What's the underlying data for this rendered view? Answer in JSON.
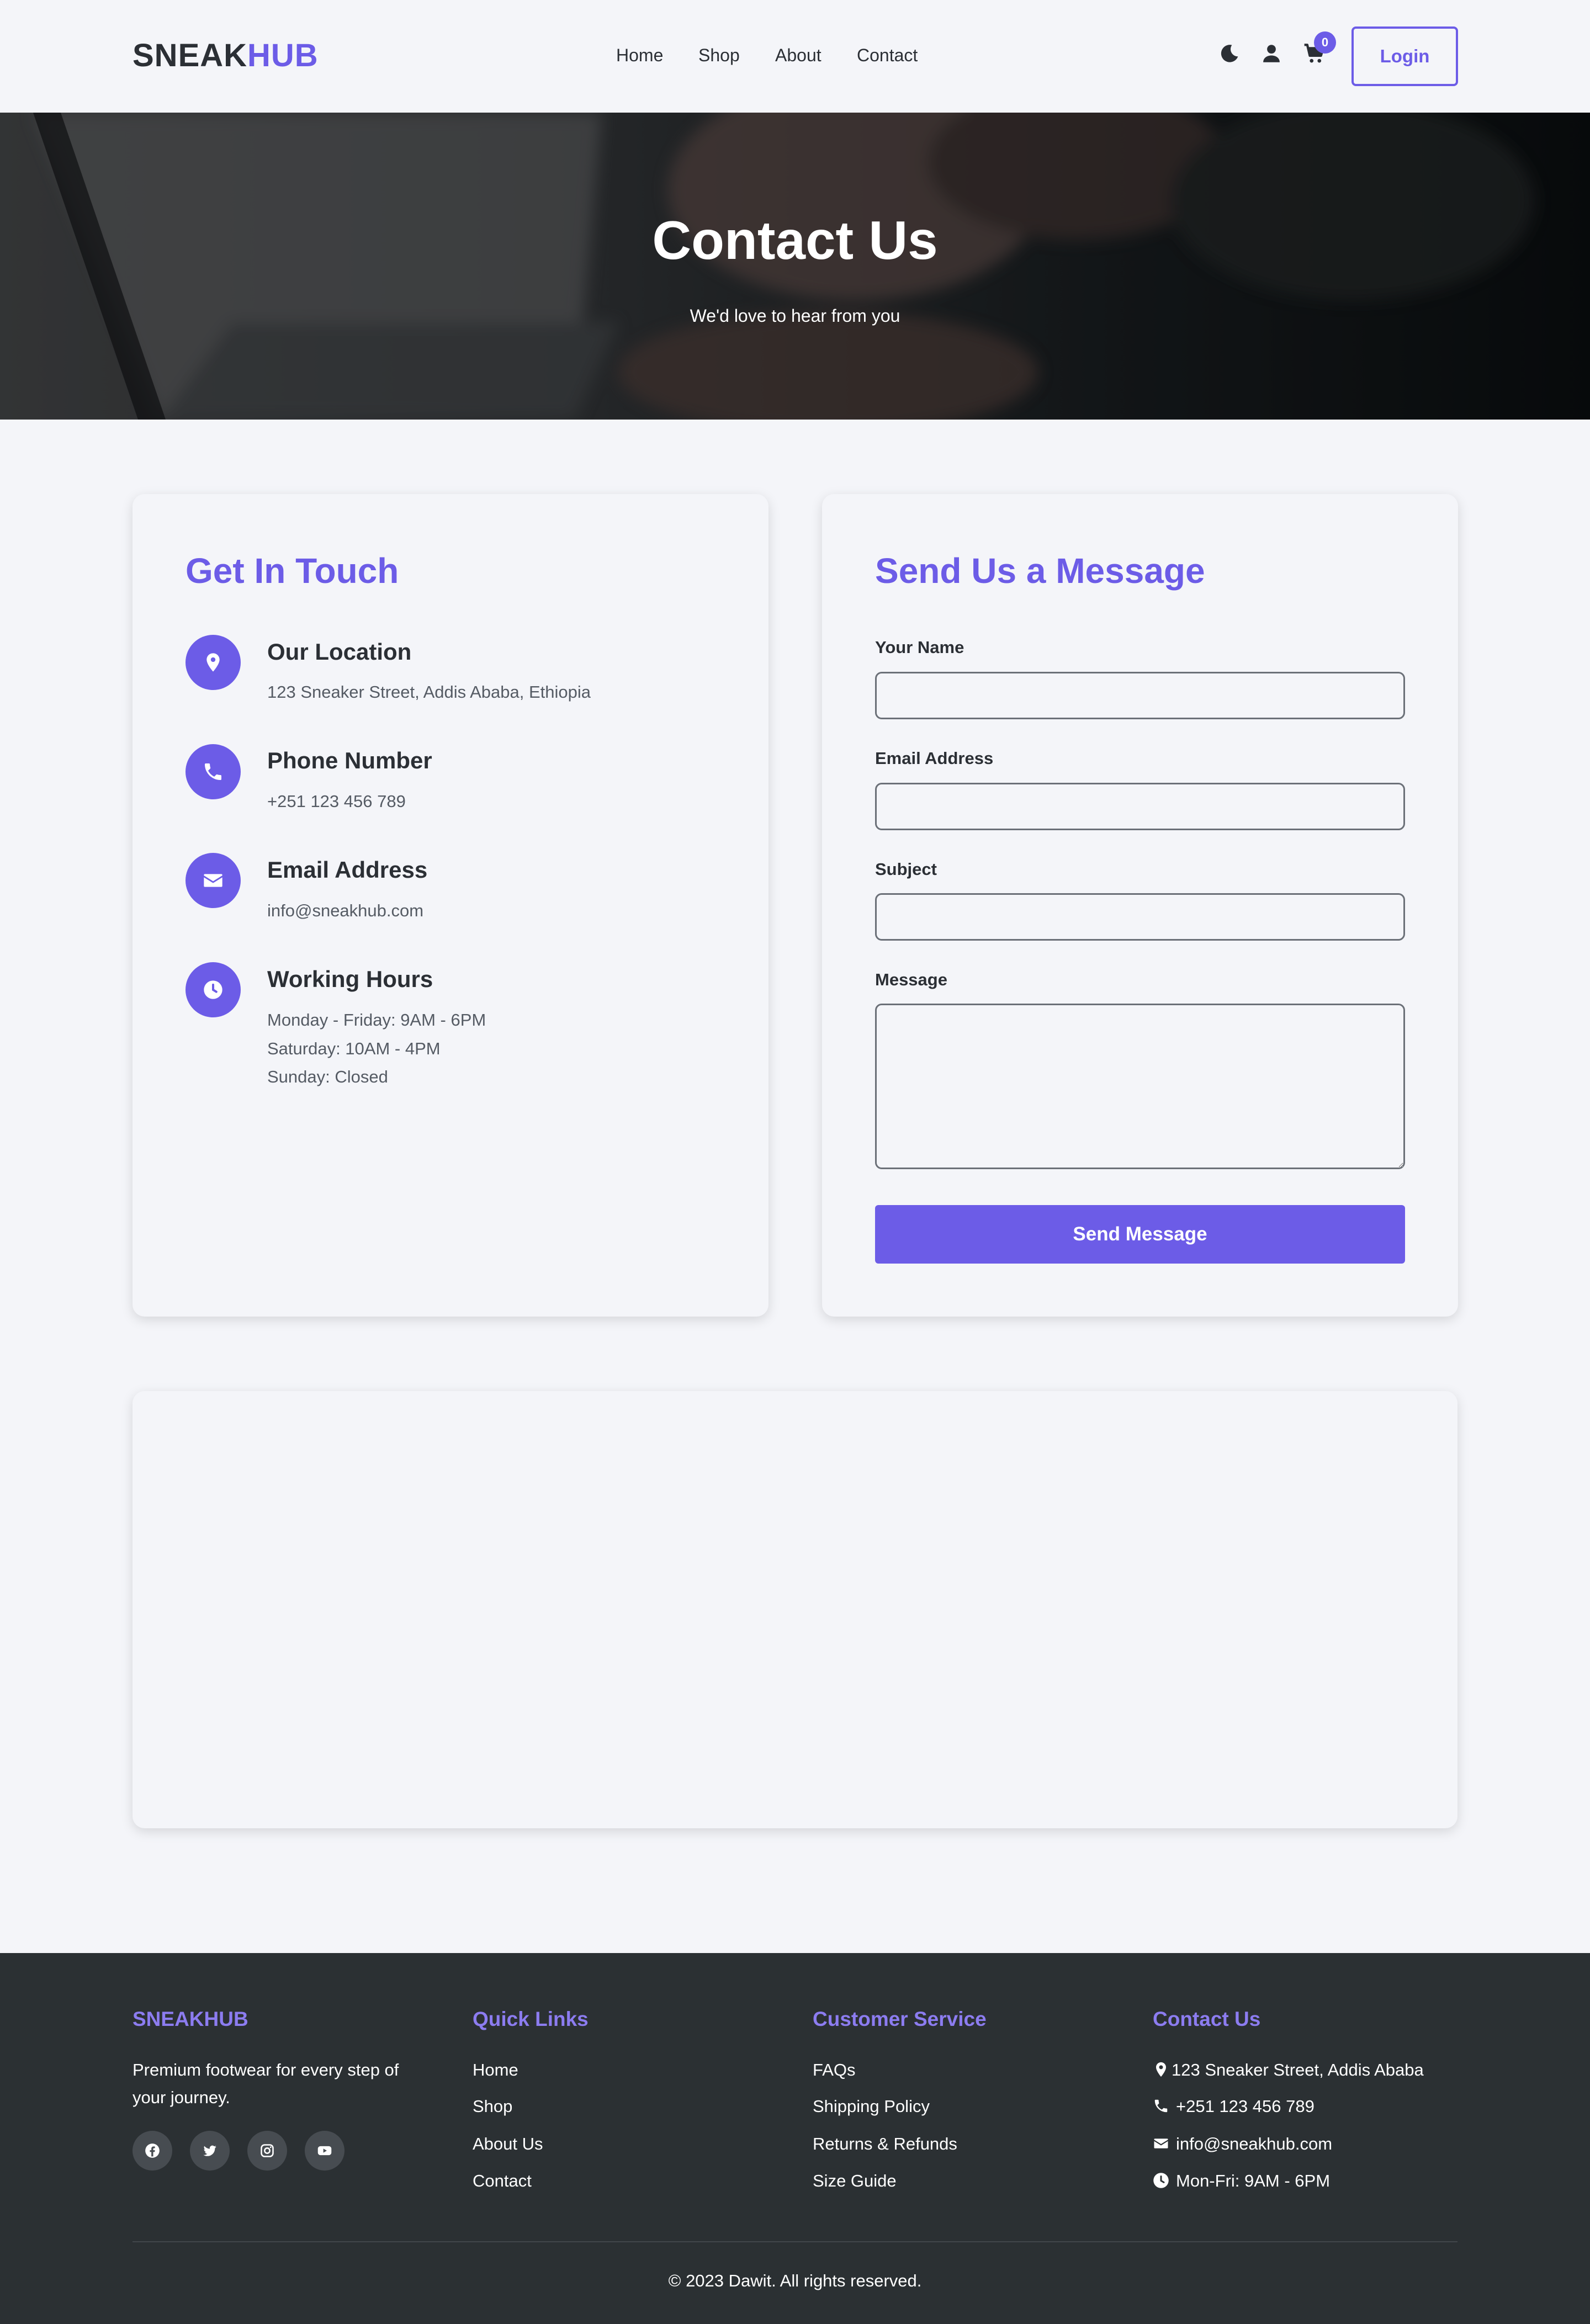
{
  "header": {
    "brand_part1": "SNEAK",
    "brand_part2": "HUB",
    "nav": [
      "Home",
      "Shop",
      "About",
      "Contact"
    ],
    "icons": [
      "moon-icon",
      "user-icon",
      "cart-icon"
    ],
    "cart_count": "0",
    "login_label": "Login"
  },
  "hero": {
    "title": "Contact Us",
    "subtitle": "We'd love to hear from you"
  },
  "contact_info": {
    "title": "Get In Touch",
    "items": [
      {
        "icon": "location-pin-icon",
        "title": "Our Location",
        "lines": [
          "123 Sneaker Street, Addis Ababa, Ethiopia"
        ]
      },
      {
        "icon": "phone-icon",
        "title": "Phone Number",
        "lines": [
          "+251 123 456 789"
        ]
      },
      {
        "icon": "envelope-icon",
        "title": "Email Address",
        "lines": [
          "info@sneakhub.com"
        ]
      },
      {
        "icon": "clock-icon",
        "title": "Working Hours",
        "lines": [
          "Monday - Friday: 9AM - 6PM",
          "Saturday: 10AM - 4PM",
          "Sunday: Closed"
        ]
      }
    ]
  },
  "form": {
    "title": "Send Us a Message",
    "fields": [
      {
        "label": "Your Name",
        "value": ""
      },
      {
        "label": "Email Address",
        "value": ""
      },
      {
        "label": "Subject",
        "value": ""
      },
      {
        "label": "Message",
        "value": ""
      }
    ],
    "submit_label": "Send Message"
  },
  "footer": {
    "brand": {
      "title": "SNEAKHUB",
      "tagline_lines": [
        "Premium footwear for every step of",
        "your journey."
      ],
      "social_icons": [
        "facebook-icon",
        "twitter-icon",
        "instagram-icon",
        "youtube-icon"
      ]
    },
    "quick_links": {
      "title": "Quick Links",
      "items": [
        "Home",
        "Shop",
        "About Us",
        "Contact"
      ]
    },
    "customer_service": {
      "title": "Customer Service",
      "items": [
        "FAQs",
        "Shipping Policy",
        "Returns & Refunds",
        "Size Guide"
      ]
    },
    "contact": {
      "title": "Contact Us",
      "items": [
        {
          "icon": "location-pin-icon",
          "text": "123 Sneaker Street, Addis Ababa"
        },
        {
          "icon": "phone-icon",
          "text": "+251 123 456 789"
        },
        {
          "icon": "envelope-icon",
          "text": "info@sneakhub.com"
        },
        {
          "icon": "clock-icon",
          "text": "Mon-Fri: 9AM - 6PM"
        }
      ]
    },
    "copyright": "© 2023 Dawit. All rights reserved."
  },
  "colors": {
    "accent": "#6c5ce7",
    "background": "#f4f5f9",
    "text": "#2b2f35",
    "footer_bg": "#2b3033",
    "footer_heading": "#8c7cf0"
  }
}
